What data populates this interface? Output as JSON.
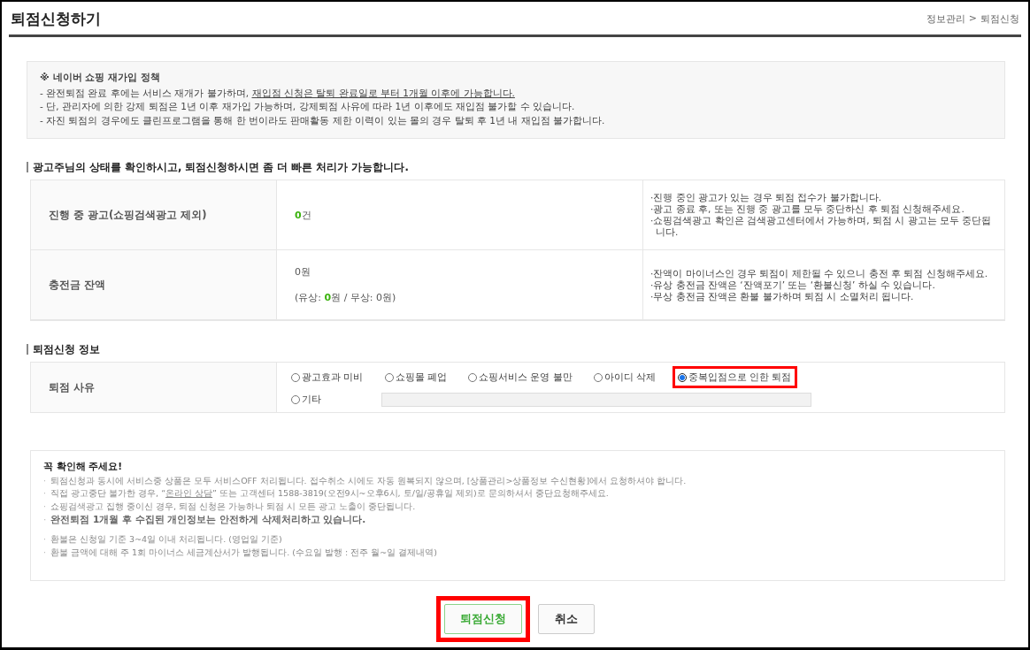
{
  "header": {
    "title": "퇴점신청하기",
    "breadcrumb": [
      "정보관리",
      "퇴점신청"
    ],
    "separator": ">"
  },
  "policy": {
    "title": "※ 네이버 쇼핑 재가입 정책",
    "lines": [
      {
        "text": "- 완전퇴점 완료 후에는 서비스 재개가 불가하며, ",
        "link": "재입점 신청은 탈퇴 완료일로 부터 1개월 이후에 가능합니다."
      },
      {
        "text": "- 단, 관리자에 의한 강제 퇴점은 1년 이후 재가입 가능하며, 강제퇴점 사유에 따라 1년 이후에도 재입점 불가할 수 있습니다."
      },
      {
        "text": "- 자진 퇴점의 경우에도 클린프로그램을 통해 한 번이라도 판매활동 제한 이력이 있는 몰의 경우 탈퇴 후 1년 내 재입점 불가합니다."
      }
    ]
  },
  "status": {
    "heading": "광고주님의 상태를 확인하시고, 퇴점신청하시면 좀 더 빠른 처리가 가능합니다.",
    "rows": [
      {
        "label": "진행 중 광고(쇼핑검색광고 제외)",
        "values": [
          "**0**건"
        ],
        "notes": [
          "·진행 중인 광고가 있는 경우 퇴점 접수가 불가합니다.",
          "·광고 종료 후, 또는 진행 중 광고를 모두 중단하신 후 퇴점 신청해주세요.",
          "·쇼핑검색광고 확인은 검색광고센터에서 가능하며, 퇴점 시 광고는 모두 중단됩니다."
        ]
      },
      {
        "label": "충전금 잔액",
        "values": [
          "0원",
          "(유상: **0**원 / 무상: 0원)"
        ],
        "notes": [
          "·잔액이 마이너스인 경우 퇴점이 제한될 수 있으니 충전 후 퇴점 신청해주세요.",
          "·유상 충전금 잔액은 ‘잔액포기’ 또는 ‘환불신청’ 하실 수 있습니다.",
          "·무상 충전금 잔액은 환불 불가하며 퇴점 시 소멸처리 됩니다."
        ]
      }
    ]
  },
  "reason": {
    "heading": "퇴점신청 정보",
    "label": "퇴점 사유",
    "options": [
      {
        "label": "광고효과 미비",
        "selected": false,
        "highlighted": false
      },
      {
        "label": "쇼핑몰 폐업",
        "selected": false,
        "highlighted": false
      },
      {
        "label": "쇼핑서비스 운영 불만",
        "selected": false,
        "highlighted": false
      },
      {
        "label": "아이디 삭제",
        "selected": false,
        "highlighted": false
      },
      {
        "label": "중복입점으로 인한 퇴점",
        "selected": true,
        "highlighted": true
      }
    ],
    "other": {
      "label": "기타",
      "selected": false,
      "disabled": true
    }
  },
  "notice": {
    "title": "꼭 확인해 주세요!",
    "bullet": "·",
    "groups": [
      [
        {
          "text": "퇴점신청과 동시에 서비스중 상품은 모두 서비스OFF 처리됩니다. 접수취소 시에도 자동 원복되지 않으며, [상품관리>상품정보 수신현황]에서 요청하셔야 합니다.",
          "bold": false
        },
        {
          "text": "직접 광고중단 불가한 경우, “",
          "link": "온라인 상담",
          "after": "” 또는 고객센터 1588-3819(오전9시~오후6시, 토/일/공휴일 제외)로 문의하셔서 중단요청해주세요.",
          "bold": false
        },
        {
          "text": "쇼핑검색광고 집행 중이신 경우, 퇴점 신청은 가능하나 퇴점 시 모든 광고 노출이 중단됩니다.",
          "bold": false
        },
        {
          "text": "완전퇴점 1개월 후 수집된 개인정보는 안전하게 삭제처리하고 있습니다.",
          "bold": true
        }
      ],
      [
        {
          "text": "환불은 신청일 기준 3~4일 이내 처리됩니다. (영업일 기준)",
          "bold": false
        },
        {
          "text": "환불 금액에 대해 주 1회 마이너스 세금계산서가 발행됩니다. (수요일 발행 : 전주 월~일 결제내역)",
          "bold": false
        }
      ]
    ]
  },
  "buttons": [
    {
      "label": "퇴점신청",
      "kind": "primary",
      "highlighted": true
    },
    {
      "label": "취소",
      "kind": "secondary",
      "highlighted": false
    }
  ]
}
